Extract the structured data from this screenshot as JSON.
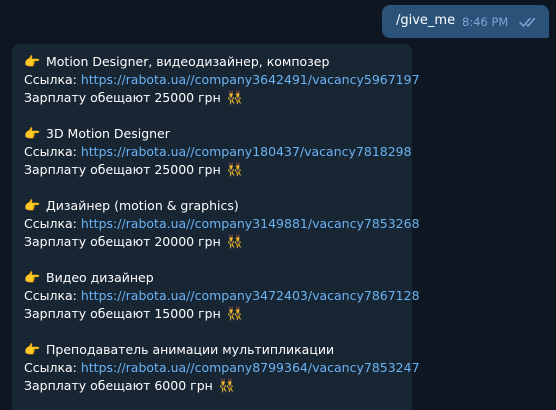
{
  "outgoing": {
    "text": "/give_me",
    "time": "8:46 PM"
  },
  "icons": {
    "pointer": "👉",
    "pointer_name": "backhand-index-pointing-right-icon",
    "salary": "👯",
    "salary_name": "people-with-bunny-ears-icon",
    "read_status": "double-check-icon"
  },
  "labels": {
    "link_prefix": "Ссылка: "
  },
  "vacancies": [
    {
      "title": "Motion Designer,  видеодизайнер,  композер",
      "link": "https://rabota.ua//company3642491/vacancy5967197",
      "salary": "Зарплату обещают 25000 грн"
    },
    {
      "title": "3D Motion Designer",
      "link": "https://rabota.ua//company180437/vacancy7818298",
      "salary": "Зарплату обещают 25000 грн"
    },
    {
      "title": "Дизайнер (motion & graphics)",
      "link": "https://rabota.ua//company3149881/vacancy7853268",
      "salary": "Зарплату обещают 20000 грн"
    },
    {
      "title": "Видео дизайнер",
      "link": "https://rabota.ua//company3472403/vacancy7867128",
      "salary": "Зарплату обещают 15000 грн"
    },
    {
      "title": "Преподаватель анимации мультипликации",
      "link": "https://rabota.ua//company8799364/vacancy7853247",
      "salary": "Зарплату обещают 6000 грн"
    }
  ]
}
